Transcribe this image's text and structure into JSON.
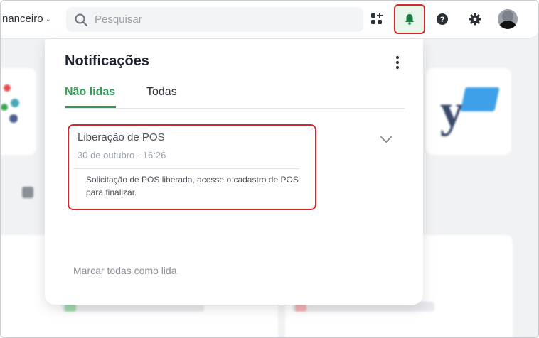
{
  "topbar": {
    "company": "nanceiro",
    "search_placeholder": "Pesquisar",
    "icons": [
      "apps-icon",
      "bell-icon",
      "help-icon",
      "gear-icon",
      "avatar"
    ]
  },
  "notifications": {
    "title": "Notificações",
    "tabs": [
      {
        "label": "Não lidas",
        "active": true
      },
      {
        "label": "Todas",
        "active": false
      }
    ],
    "items": [
      {
        "title": "Liberação de POS",
        "date": "30 de outubro - 16:26",
        "body": "Solicitação de POS liberada, acesse o cadastro de POS para finalizar."
      }
    ],
    "mark_all": "Marcar todas como lida"
  },
  "colors": {
    "accent_green": "#2e9e55",
    "highlight_red": "#d8262c"
  }
}
